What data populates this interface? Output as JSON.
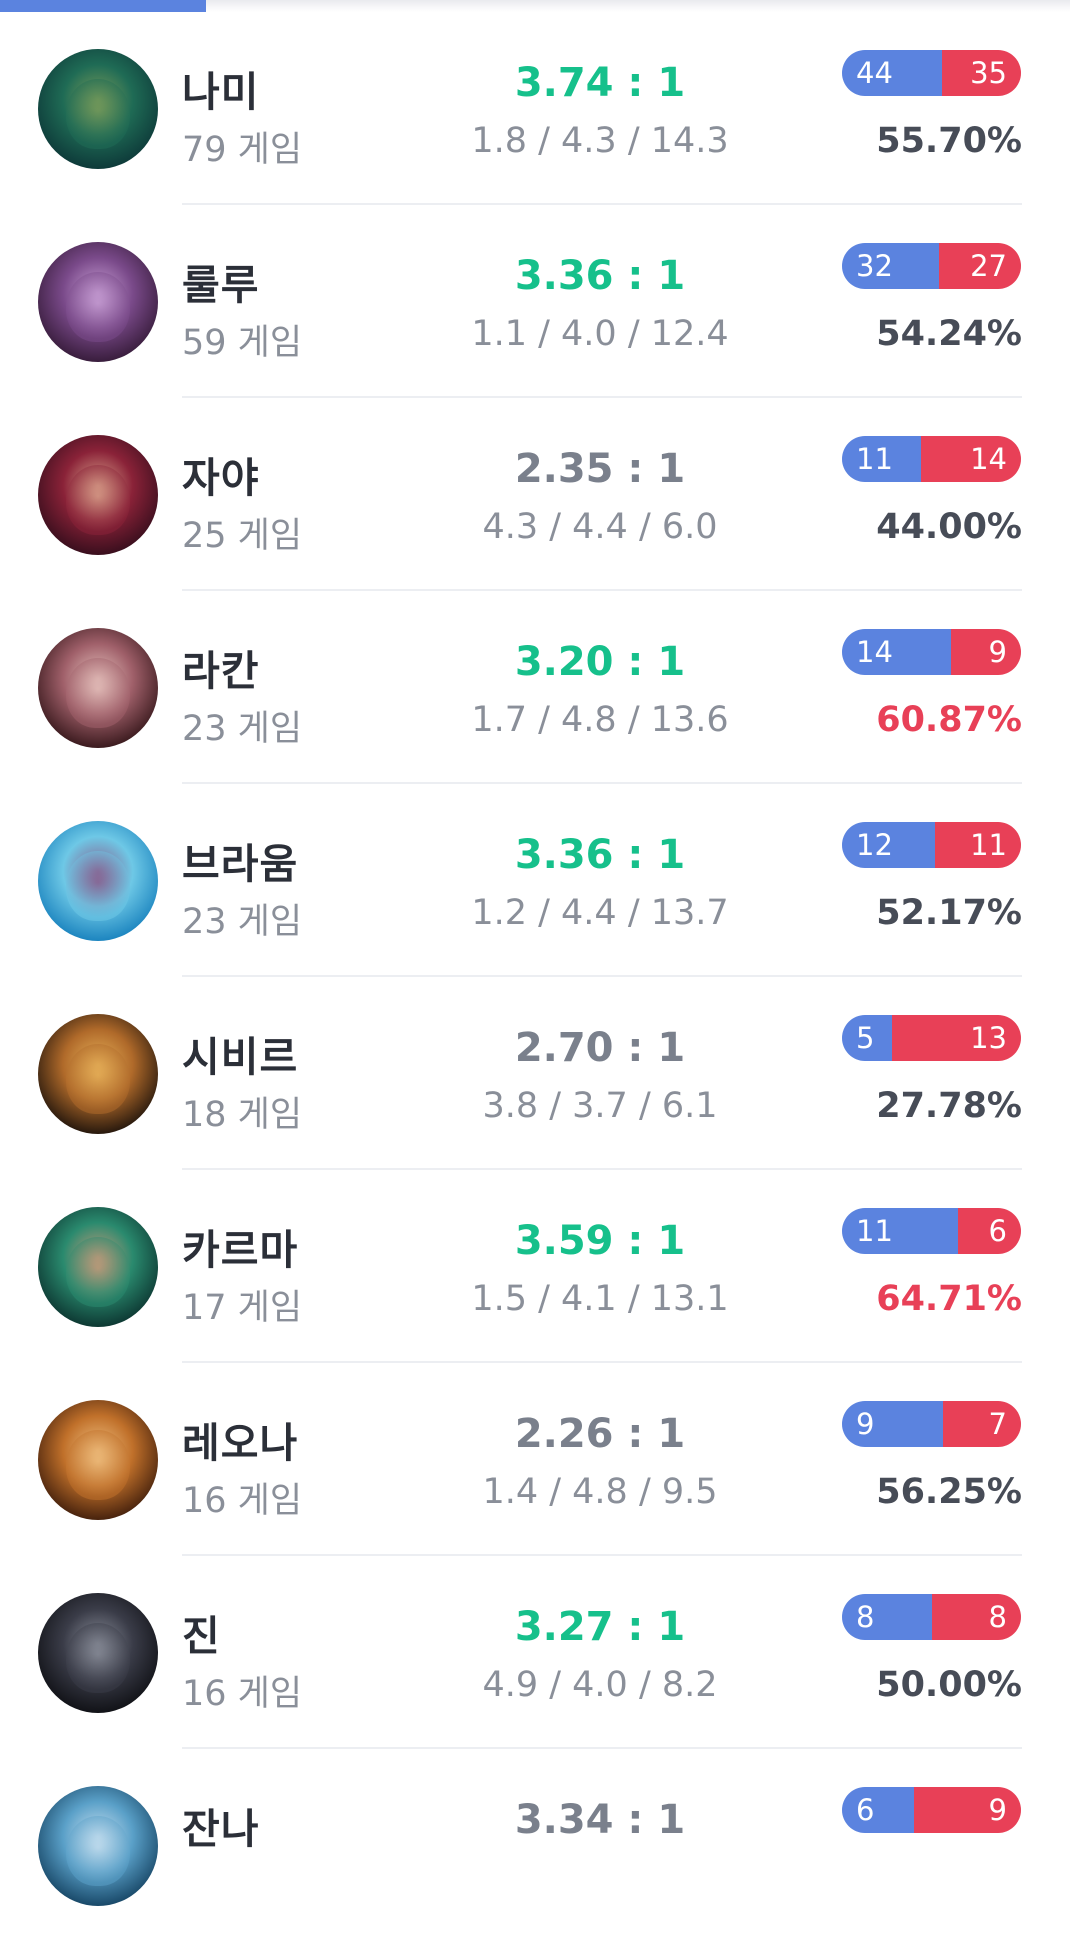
{
  "colors": {
    "tab_indicator": "#5b83df",
    "win": "#5b83df",
    "loss": "#e84057",
    "kda_good": "#16c08b",
    "kda_normal": "#7a808c",
    "winrate_high": "#e84057",
    "winrate_normal": "#474c57"
  },
  "champions": [
    {
      "name": "나미",
      "games": "79 게임",
      "kda_ratio": "3.74 : 1",
      "kda_tier": "good",
      "kda_avg": "1.8 / 4.3 / 14.3",
      "wins": 44,
      "losses": 35,
      "win_label": "44",
      "loss_label": "35",
      "winrate": "55.70%",
      "winrate_tier": "normal",
      "avatar_colors": [
        "#0e3b3a",
        "#1f6b55",
        "#7a9c5a"
      ]
    },
    {
      "name": "룰루",
      "games": "59 게임",
      "kda_ratio": "3.36 : 1",
      "kda_tier": "good",
      "kda_avg": "1.1 / 4.0 / 12.4",
      "wins": 32,
      "losses": 27,
      "win_label": "32",
      "loss_label": "27",
      "winrate": "54.24%",
      "winrate_tier": "normal",
      "avatar_colors": [
        "#3a1e3e",
        "#7a4a8a",
        "#c9a0d6"
      ]
    },
    {
      "name": "자야",
      "games": "25 게임",
      "kda_ratio": "2.35 : 1",
      "kda_tier": "normal",
      "kda_avg": "4.3 / 4.4 / 6.0",
      "wins": 11,
      "losses": 14,
      "win_label": "11",
      "loss_label": "14",
      "winrate": "44.00%",
      "winrate_tier": "normal",
      "avatar_colors": [
        "#3b0f1e",
        "#8a2238",
        "#d9a08a"
      ]
    },
    {
      "name": "라칸",
      "games": "23 게임",
      "kda_ratio": "3.20 : 1",
      "kda_tier": "good",
      "kda_avg": "1.7 / 4.8 / 13.6",
      "wins": 14,
      "losses": 9,
      "win_label": "14",
      "loss_label": "9",
      "winrate": "60.87%",
      "winrate_tier": "high",
      "avatar_colors": [
        "#3d1c20",
        "#a0606a",
        "#e6c2bd"
      ]
    },
    {
      "name": "브라움",
      "games": "23 게임",
      "kda_ratio": "3.36 : 1",
      "kda_tier": "good",
      "kda_avg": "1.2 / 4.4 / 13.7",
      "wins": 12,
      "losses": 11,
      "win_label": "12",
      "loss_label": "11",
      "winrate": "52.17%",
      "winrate_tier": "normal",
      "avatar_colors": [
        "#1e86c0",
        "#6ec8e6",
        "#8a5a8a"
      ]
    },
    {
      "name": "시비르",
      "games": "18 게임",
      "kda_ratio": "2.70 : 1",
      "kda_tier": "normal",
      "kda_avg": "3.8 / 3.7 / 6.1",
      "wins": 5,
      "losses": 13,
      "win_label": "5",
      "loss_label": "13",
      "winrate": "27.78%",
      "winrate_tier": "normal",
      "avatar_colors": [
        "#2a1a0e",
        "#b06a2a",
        "#e8b25a"
      ]
    },
    {
      "name": "카르마",
      "games": "17 게임",
      "kda_ratio": "3.59 : 1",
      "kda_tier": "good",
      "kda_avg": "1.5 / 4.1 / 13.1",
      "wins": 11,
      "losses": 6,
      "win_label": "11",
      "loss_label": "6",
      "winrate": "64.71%",
      "winrate_tier": "high",
      "avatar_colors": [
        "#0e3a34",
        "#2a8a6e",
        "#c99a7a"
      ]
    },
    {
      "name": "레오나",
      "games": "16 게임",
      "kda_ratio": "2.26 : 1",
      "kda_tier": "normal",
      "kda_avg": "1.4 / 4.8 / 9.5",
      "wins": 9,
      "losses": 7,
      "win_label": "9",
      "loss_label": "7",
      "winrate": "56.25%",
      "winrate_tier": "normal",
      "avatar_colors": [
        "#4a240e",
        "#c0702a",
        "#f0c080"
      ]
    },
    {
      "name": "진",
      "games": "16 게임",
      "kda_ratio": "3.27 : 1",
      "kda_tier": "good",
      "kda_avg": "4.9 / 4.0 / 8.2",
      "wins": 8,
      "losses": 8,
      "win_label": "8",
      "loss_label": "8",
      "winrate": "50.00%",
      "winrate_tier": "normal",
      "avatar_colors": [
        "#121318",
        "#3a3c48",
        "#8a8e9a"
      ]
    },
    {
      "name": "잔나",
      "games": "",
      "kda_ratio": "3.34 : 1",
      "kda_tier": "normal",
      "kda_avg": "",
      "wins": 6,
      "losses": 9,
      "win_label": "6",
      "loss_label": "9",
      "winrate": "",
      "winrate_tier": "normal",
      "avatar_colors": [
        "#1a4a6a",
        "#5aa0c8",
        "#c8e0f0"
      ]
    }
  ]
}
